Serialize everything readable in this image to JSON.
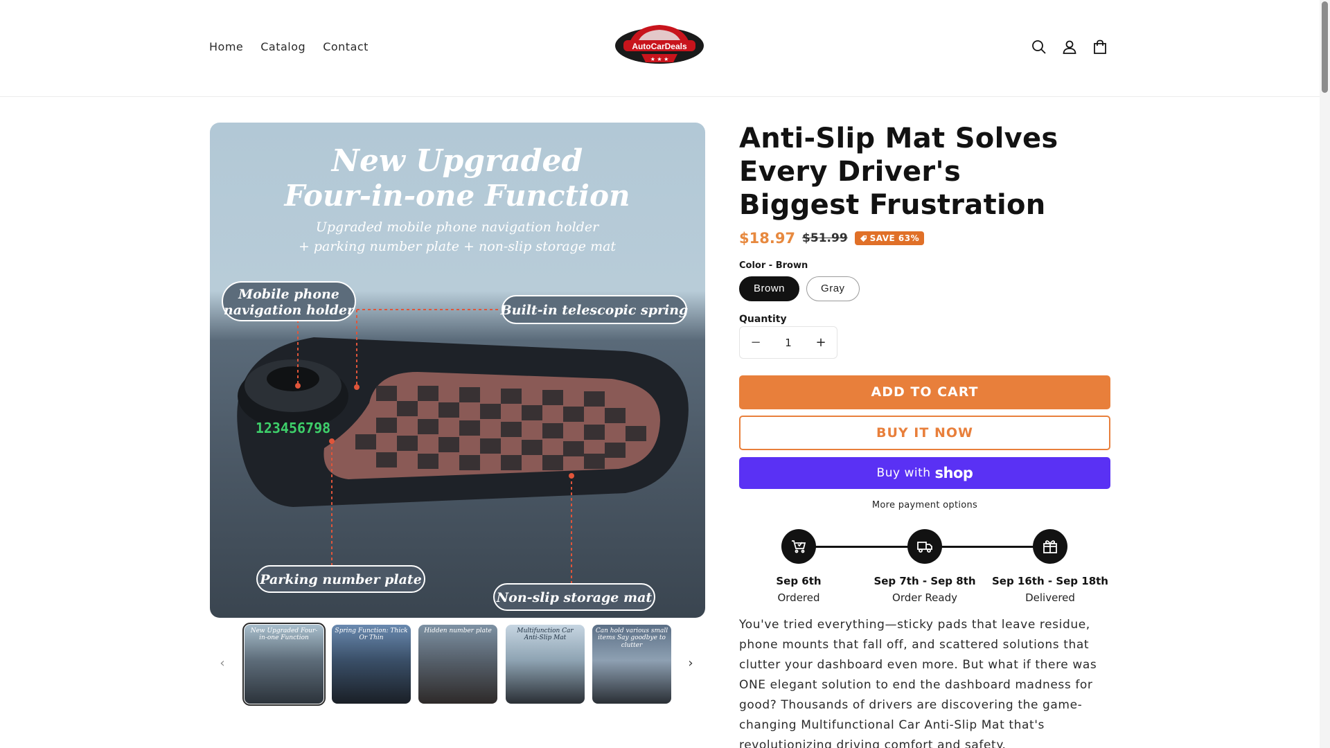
{
  "header": {
    "nav": [
      {
        "label": "Home"
      },
      {
        "label": "Catalog"
      },
      {
        "label": "Contact"
      }
    ],
    "logo_text": "AutoCarDeals",
    "icons": [
      "search-icon",
      "account-icon",
      "cart-icon"
    ]
  },
  "gallery": {
    "main_image": {
      "headline_line1": "New Upgraded",
      "headline_line2": "Four-in-one Function",
      "sub_line1": "Upgraded mobile phone navigation holder",
      "sub_line2": "+ parking number plate + non-slip storage mat",
      "callouts": {
        "phone_holder_1": "Mobile phone",
        "phone_holder_2": "navigation holder",
        "spring": "Built-in telescopic spring",
        "plate": "Parking number plate",
        "mat": "Non-slip storage mat"
      },
      "digits": "123456798"
    },
    "thumbnails": [
      {
        "caption": "New Upgraded Four-in-one Function",
        "active": true
      },
      {
        "caption": "Spring Function: Thick Or Thin",
        "active": false
      },
      {
        "caption": "Hidden number plate",
        "active": false
      },
      {
        "caption": "Multifunction Car Anti-Slip Mat",
        "active": false
      },
      {
        "caption": "Can hold various small items Say goodbye to clutter",
        "active": false
      }
    ],
    "prev_icon": "chevron-left-icon",
    "next_icon": "chevron-right-icon"
  },
  "product": {
    "title": "Anti-Slip Mat Solves Every Driver's Biggest Frustration",
    "price_sale": "$18.97",
    "price_original": "$51.99",
    "save_badge": "SAVE 63%",
    "color_label": "Color - Brown",
    "colors": [
      {
        "label": "Brown",
        "selected": true
      },
      {
        "label": "Gray",
        "selected": false
      }
    ],
    "quantity_label": "Quantity",
    "quantity_value": "1",
    "minus": "−",
    "plus": "+",
    "add_to_cart": "ADD TO CART",
    "buy_now": "BUY IT NOW",
    "shop_pay_prefix": "Buy with",
    "shop_pay_brand": "shop",
    "more_payment": "More payment options"
  },
  "timeline": [
    {
      "date": "Sep 6th",
      "label": "Ordered",
      "icon": "cart-check-icon"
    },
    {
      "date": "Sep 7th - Sep 8th",
      "label": "Order Ready",
      "icon": "truck-icon"
    },
    {
      "date": "Sep 16th - Sep 18th",
      "label": "Delivered",
      "icon": "gift-icon"
    }
  ],
  "description": "You've tried everything—sticky pads that leave residue, phone mounts that fall off, and scattered solutions that clutter your dashboard even more. But what if there was ONE elegant solution to end the dashboard madness for good? Thousands of drivers are discovering the game-changing Multifunctional Car Anti-Slip Mat that's revolutionizing driving comfort and safety.",
  "colors": {
    "accent": "#e87f3b",
    "shop_pay": "#5a31f4",
    "badge": "#e07028",
    "text": "#121212"
  }
}
